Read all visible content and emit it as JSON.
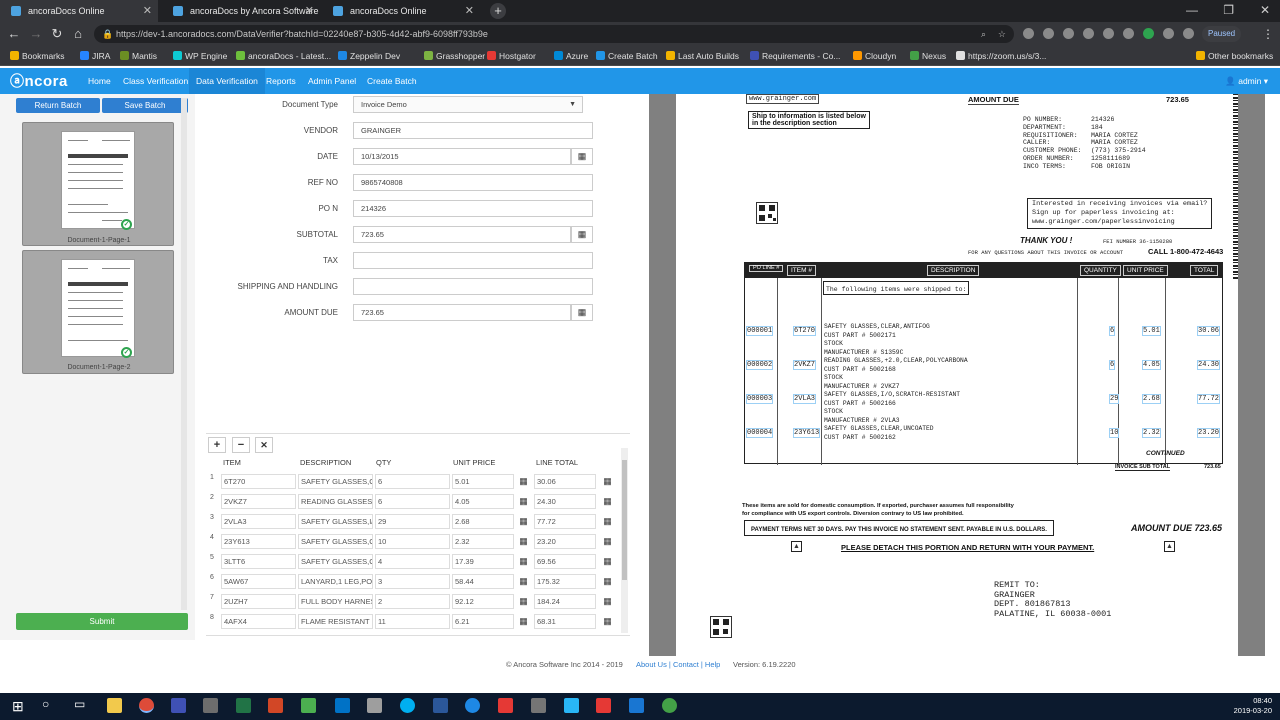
{
  "browser": {
    "tabs": [
      {
        "title": "ancoraDocs Online"
      },
      {
        "title": "ancoraDocs by Ancora Software"
      },
      {
        "title": "ancoraDocs Online"
      }
    ],
    "url": "https://dev-1.ancoradocs.com/DataVerifier?batchId=02240e87-b305-4d42-abf9-6098ff793b9e",
    "paused_label": "Paused",
    "bookmarks": [
      {
        "label": "Bookmarks",
        "color": "#f2b400"
      },
      {
        "label": "JIRA",
        "color": "#2684ff"
      },
      {
        "label": "Mantis",
        "color": "#6b8e23"
      },
      {
        "label": "WP Engine",
        "color": "#0ecad4"
      },
      {
        "label": "ancoraDocs - Latest...",
        "color": "#6dbf3c"
      },
      {
        "label": "Zeppelin Dev",
        "color": "#1e88e5"
      },
      {
        "label": "Grasshopper",
        "color": "#7cb342"
      },
      {
        "label": "Hostgator",
        "color": "#e53935"
      },
      {
        "label": "Azure",
        "color": "#0089d6"
      },
      {
        "label": "Create Batch",
        "color": "#2196e8"
      },
      {
        "label": "Last Auto Builds",
        "color": "#f2b400"
      },
      {
        "label": "Requirements - Co...",
        "color": "#3f51b5"
      },
      {
        "label": "Cloudyn",
        "color": "#ff9800"
      },
      {
        "label": "Nexus",
        "color": "#43a047"
      },
      {
        "label": "https://zoom.us/s/3...",
        "color": "#e0e0e0"
      }
    ],
    "other_bookmarks": "Other bookmarks"
  },
  "app": {
    "logo": "ncora",
    "menu": [
      "Home",
      "Class Verification",
      "Data Verification",
      "Reports",
      "Admin Panel",
      "Create Batch"
    ],
    "active_menu": "Data Verification",
    "user": "admin ▾"
  },
  "left": {
    "return_batch": "Return Batch",
    "save_batch": "Save Batch",
    "pages": [
      {
        "label": "Document-1-Page-1"
      },
      {
        "label": "Document-1-Page-2"
      }
    ],
    "submit": "Submit"
  },
  "form": {
    "fields": [
      {
        "label": "Document Type",
        "value": "Invoice Demo",
        "kind": "select"
      },
      {
        "label": "VENDOR",
        "value": "GRAINGER",
        "kind": "text"
      },
      {
        "label": "DATE",
        "value": "10/13/2015",
        "kind": "date"
      },
      {
        "label": "REF NO",
        "value": "9865740808",
        "kind": "text"
      },
      {
        "label": "PO N",
        "value": "214326",
        "kind": "text"
      },
      {
        "label": "SUBTOTAL",
        "value": "723.65",
        "kind": "grid"
      },
      {
        "label": "TAX",
        "value": "",
        "kind": "text"
      },
      {
        "label": "SHIPPING AND HANDLING",
        "value": "",
        "kind": "text"
      },
      {
        "label": "AMOUNT DUE",
        "value": "723.65",
        "kind": "grid"
      }
    ]
  },
  "line_items": {
    "columns": [
      "ITEM",
      "DESCRIPTION",
      "QTY",
      "UNIT PRICE",
      "LINE TOTAL"
    ],
    "rows": [
      {
        "n": "1",
        "item": "6T270",
        "desc": "SAFETY GLASSES,CLEAR",
        "qty": "6",
        "price": "5.01",
        "total": "30.06"
      },
      {
        "n": "2",
        "item": "2VKZ7",
        "desc": "READING GLASSES,+2.0",
        "qty": "6",
        "price": "4.05",
        "total": "24.30"
      },
      {
        "n": "3",
        "item": "2VLA3",
        "desc": "SAFETY GLASSES,I/O",
        "qty": "29",
        "price": "2.68",
        "total": "77.72"
      },
      {
        "n": "4",
        "item": "23Y613",
        "desc": "SAFETY GLASSES,CLEAR",
        "qty": "10",
        "price": "2.32",
        "total": "23.20"
      },
      {
        "n": "5",
        "item": "3LTT6",
        "desc": "SAFETY GLASSES,CLEAR",
        "qty": "4",
        "price": "17.39",
        "total": "69.56"
      },
      {
        "n": "6",
        "item": "5AW67",
        "desc": "LANYARD,1 LEG,POLY",
        "qty": "3",
        "price": "58.44",
        "total": "175.32"
      },
      {
        "n": "7",
        "item": "2UZH7",
        "desc": "FULL BODY HARNESS",
        "qty": "2",
        "price": "92.12",
        "total": "184.24"
      },
      {
        "n": "8",
        "item": "4AFX4",
        "desc": "FLAME RESISTANT HOOD",
        "qty": "11",
        "price": "6.21",
        "total": "68.31"
      }
    ]
  },
  "document": {
    "website": "www.grainger.com",
    "amount_due_label": "AMOUNT DUE",
    "amount_due_top": "723.65",
    "ship_info": [
      "Ship to information is listed below",
      "in the description section"
    ],
    "po_labels": [
      "PO NUMBER:",
      "DEPARTMENT:",
      "REQUISITIONER:",
      "CALLER:",
      "CUSTOMER PHONE:",
      "ORDER NUMBER:",
      "INCO TERMS:"
    ],
    "po_values": [
      "214326",
      "184",
      "MARIA CORTEZ",
      "MARIA CORTEZ",
      "(773) 375-2914",
      "1258111689",
      "FOB ORIGIN"
    ],
    "email_box": [
      "Interested in receiving invoices via email?",
      "Sign up for paperless invoicing at:",
      "www.grainger.com/paperlessinvoicing"
    ],
    "thank_you": "THANK YOU !",
    "fei": "FEI NUMBER 36-1150280",
    "questions": "FOR ANY QUESTIONS ABOUT THIS INVOICE OR ACCOUNT",
    "call": "CALL 1-800-472-4643",
    "table_headers": [
      "PO LINE #",
      "ITEM #",
      "DESCRIPTION",
      "QUANTITY",
      "UNIT PRICE",
      "TOTAL"
    ],
    "shipped_note": "The following items were shipped to:",
    "lines": [
      {
        "po": "000001",
        "item": "6T270",
        "desc": [
          "SAFETY GLASSES,CLEAR,ANTIFOG",
          "CUST PART # 5002171",
          "STOCK",
          "MANUFACTURER # S1359C"
        ],
        "qty": "6",
        "price": "5.01",
        "total": "30.06"
      },
      {
        "po": "000002",
        "item": "2VKZ7",
        "desc": [
          "READING GLASSES,+2.0,CLEAR,POLYCARBONA",
          "CUST PART # 5002168",
          "STOCK",
          "MANUFACTURER # 2VKZ7"
        ],
        "qty": "6",
        "price": "4.05",
        "total": "24.30"
      },
      {
        "po": "000003",
        "item": "2VLA3",
        "desc": [
          "SAFETY GLASSES,I/O,SCRATCH-RESISTANT",
          "CUST PART # 5002166",
          "STOCK",
          "MANUFACTURER # 2VLA3"
        ],
        "qty": "29",
        "price": "2.68",
        "total": "77.72"
      },
      {
        "po": "000004",
        "item": "23Y613",
        "desc": [
          "SAFETY GLASSES,CLEAR,UNCOATED",
          "CUST PART # 5002162"
        ],
        "qty": "10",
        "price": "2.32",
        "total": "23.20"
      }
    ],
    "continued": "CONTINUED",
    "invoice_subtotal_label": "INVOICE SUB TOTAL",
    "invoice_subtotal": "723.65",
    "export_note": [
      "These items are sold for domestic consumption.  If exported, purchaser assumes full responsibility",
      "for compliance with US export controls.  Diversion contrary to US law prohibited."
    ],
    "payment_terms": "PAYMENT TERMS NET  30 DAYS. PAY THIS INVOICE NO STATEMENT SENT. PAYABLE IN U.S. DOLLARS.",
    "amount_due_bottom": "AMOUNT DUE 723.65",
    "detach": "PLEASE DETACH THIS PORTION AND RETURN WITH YOUR PAYMENT.",
    "remit": [
      "REMIT TO:",
      "GRAINGER",
      "DEPT. 801867813",
      "PALATINE,  IL  60038-0001"
    ]
  },
  "footer": {
    "copyright": "© Ancora Software Inc 2014 - 2019",
    "links": "About Us | Contact | Help",
    "version": "Version: 6.19.2220"
  },
  "taskbar": {
    "time": "08:40",
    "date": "2019-03-20"
  }
}
